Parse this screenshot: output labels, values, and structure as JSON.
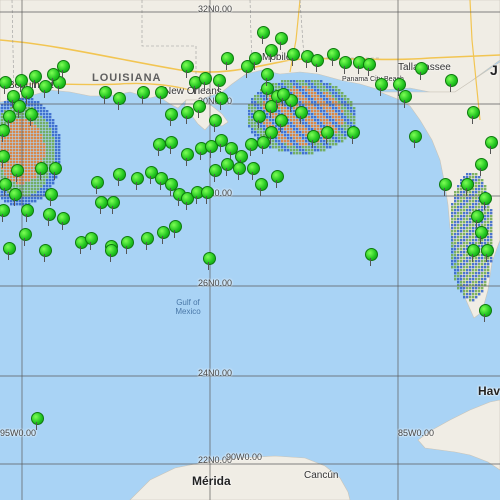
{
  "map": {
    "colors": {
      "water": "#a9d3f5",
      "land": "#f0ede5",
      "grid": "#5b5b5b",
      "marker": "#22c01e",
      "heat_blue": "#2f5fc8",
      "heat_orange": "#e07a2a",
      "heat_green": "#6aa64b"
    },
    "gridlines": {
      "lat": [
        {
          "label": "32N0.00"
        },
        {
          "label": "30N0.00"
        },
        {
          "label": "28N0.00"
        },
        {
          "label": "26N0.00"
        },
        {
          "label": "24N0.00"
        },
        {
          "label": "22N0.00"
        }
      ],
      "lon": [
        {
          "label": "95W0.00"
        },
        {
          "label": "90W0.00"
        },
        {
          "label": "85W0.00"
        }
      ]
    },
    "labels": {
      "louisiana": "LOUISIANA",
      "beaumont": "Beaumont",
      "new_orleans": "New Orleans",
      "mobile": "Mobile",
      "tallahassee": "Tallahassee",
      "panama_city": "Panama City Beach",
      "gulf": "Gulf of Mexico",
      "havana": "Hav",
      "merida": "Mérida",
      "cancun": "Cancún",
      "jacksonville": "J"
    },
    "marker_icon": "green-map-pin-icon"
  }
}
